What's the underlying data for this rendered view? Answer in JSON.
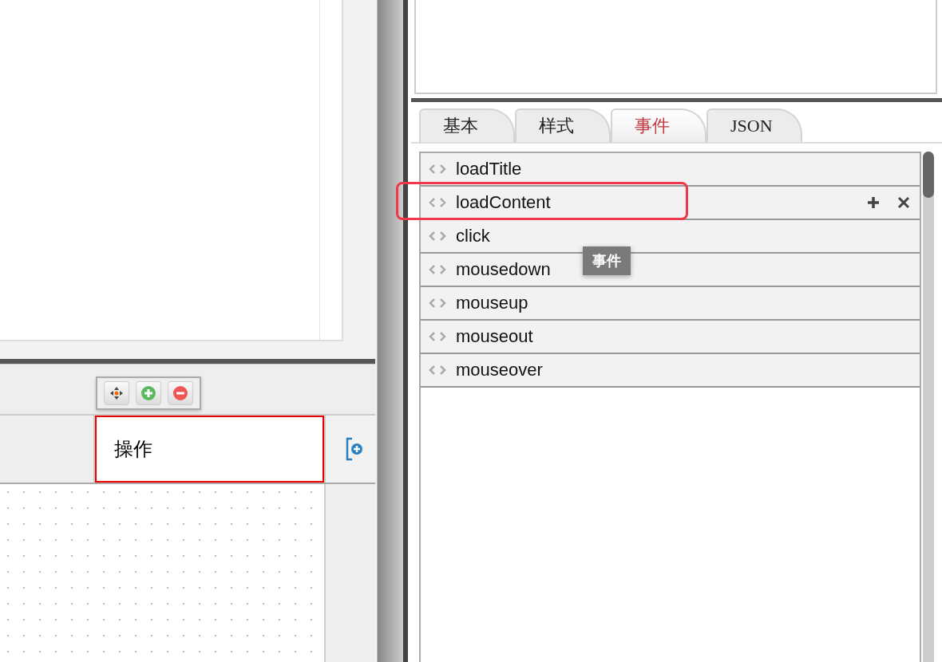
{
  "column_header": {
    "label": "操作",
    "highlighted": true
  },
  "tabs": [
    {
      "label": "基本",
      "selected": false
    },
    {
      "label": "样式",
      "selected": false
    },
    {
      "label": "事件",
      "selected": true
    },
    {
      "label": "JSON",
      "selected": false
    }
  ],
  "events": [
    {
      "name": "loadTitle",
      "hovered": false,
      "highlighted": false
    },
    {
      "name": "loadContent",
      "hovered": true,
      "highlighted": true
    },
    {
      "name": "click",
      "hovered": false,
      "highlighted": false
    },
    {
      "name": "mousedown",
      "hovered": false,
      "highlighted": false
    },
    {
      "name": "mouseup",
      "hovered": false,
      "highlighted": false
    },
    {
      "name": "mouseout",
      "hovered": false,
      "highlighted": false
    },
    {
      "name": "mouseover",
      "hovered": false,
      "highlighted": false
    }
  ],
  "tooltip": "事件"
}
